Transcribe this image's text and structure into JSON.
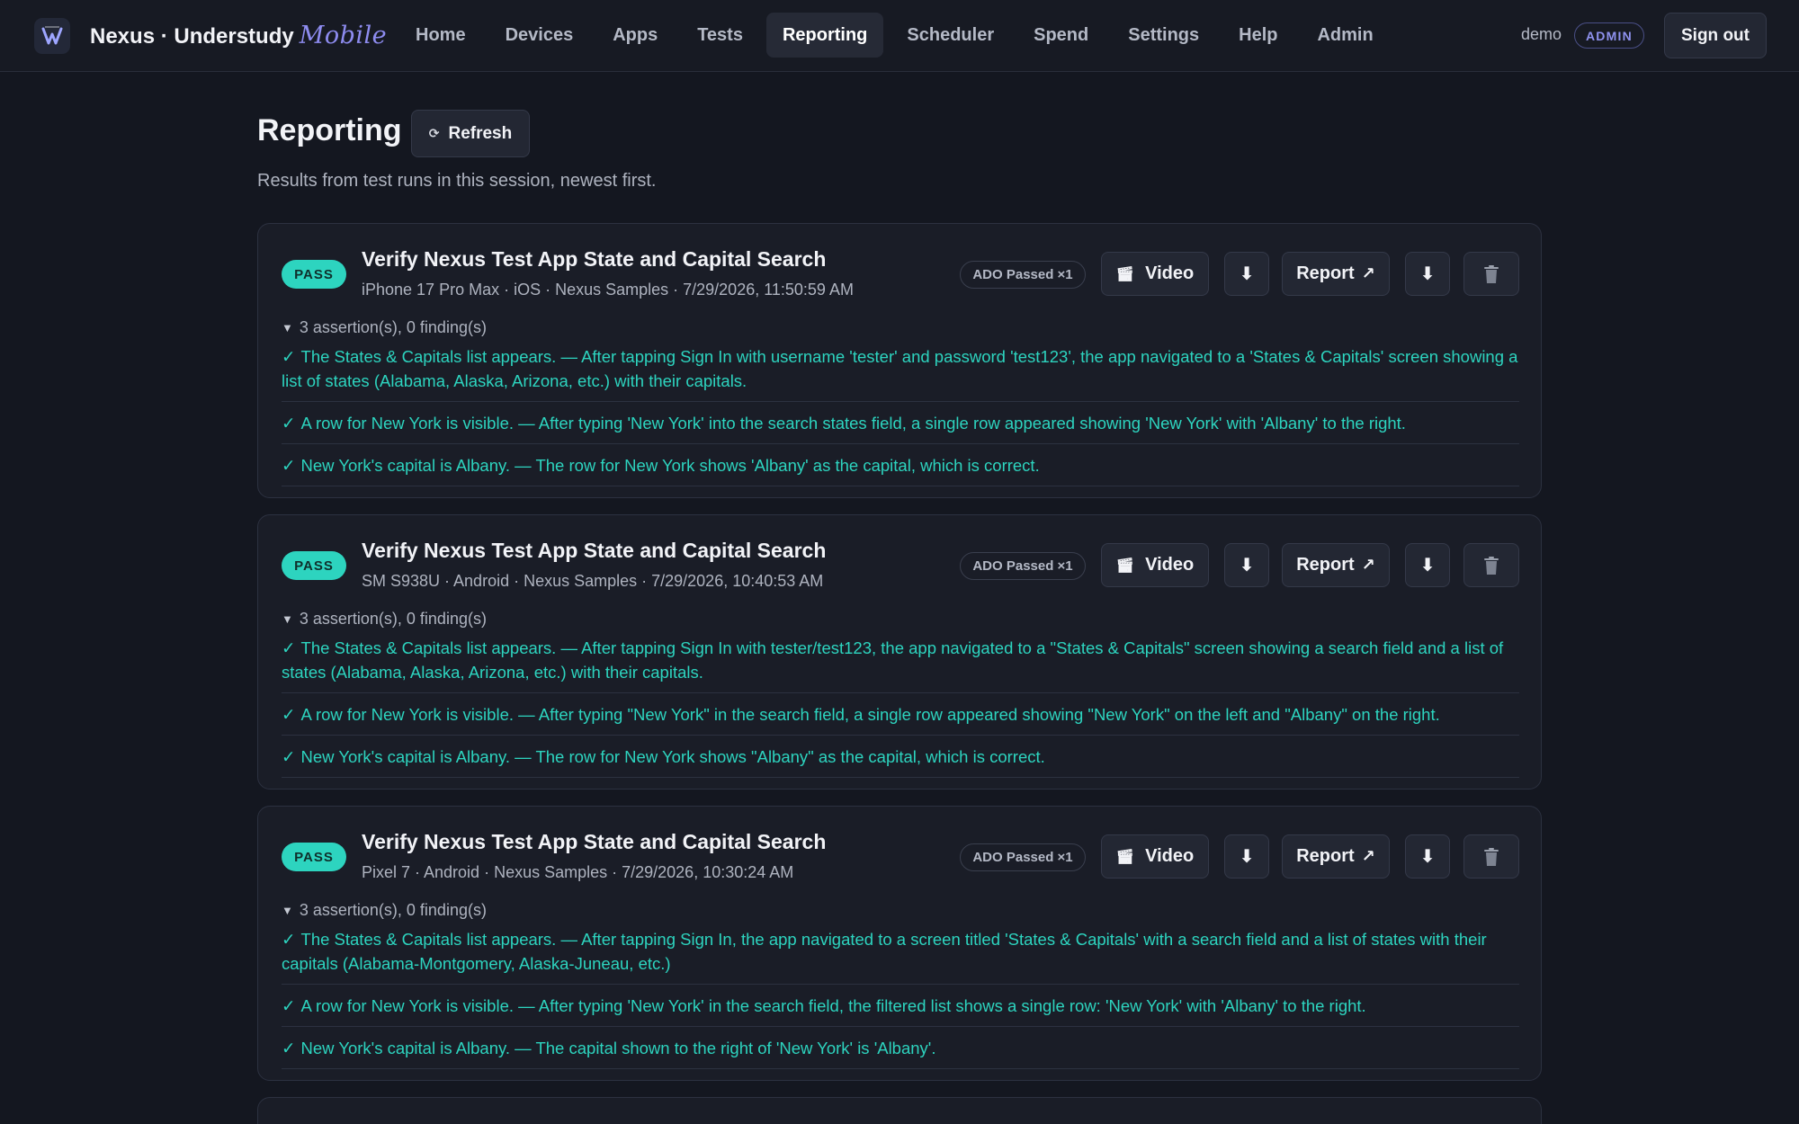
{
  "app": {
    "brand": "Nexus · Understudy",
    "brand_accent": "Mobile",
    "accent_color": "#8e8cf0",
    "pass_color": "#2dd4bf"
  },
  "nav": {
    "items": [
      {
        "label": "Home",
        "active": false
      },
      {
        "label": "Devices",
        "active": false
      },
      {
        "label": "Apps",
        "active": false
      },
      {
        "label": "Tests",
        "active": false
      },
      {
        "label": "Reporting",
        "active": true
      },
      {
        "label": "Scheduler",
        "active": false
      },
      {
        "label": "Spend",
        "active": false
      },
      {
        "label": "Settings",
        "active": false
      },
      {
        "label": "Help",
        "active": false
      },
      {
        "label": "Admin",
        "active": false
      }
    ],
    "user": "demo",
    "role_badge": "ADMIN",
    "signout_label": "Sign out"
  },
  "page": {
    "title": "Reporting",
    "refresh_label": "Refresh",
    "subtitle": "Results from test runs in this session, newest first."
  },
  "results": [
    {
      "status": "PASS",
      "title": "Verify Nexus Test App State and Capital Search",
      "meta": "iPhone 17 Pro Max · iOS · Nexus Samples · 7/29/2026, 11:50:59 AM",
      "ado": "ADO Passed ×1",
      "video_label": "Video",
      "report_label": "Report",
      "summary": "3 assertion(s), 0 finding(s)",
      "assertions": [
        "The States & Capitals list appears. — After tapping Sign In with username 'tester' and password 'test123', the app navigated to a 'States & Capitals' screen showing a list of states (Alabama, Alaska, Arizona, etc.) with their capitals.",
        "A row for New York is visible. — After typing 'New York' into the search states field, a single row appeared showing 'New York' with 'Albany' to the right.",
        "New York's capital is Albany. — The row for New York shows 'Albany' as the capital, which is correct."
      ]
    },
    {
      "status": "PASS",
      "title": "Verify Nexus Test App State and Capital Search",
      "meta": "SM S938U · Android · Nexus Samples · 7/29/2026, 10:40:53 AM",
      "ado": "ADO Passed ×1",
      "video_label": "Video",
      "report_label": "Report",
      "summary": "3 assertion(s), 0 finding(s)",
      "assertions": [
        "The States & Capitals list appears. — After tapping Sign In with tester/test123, the app navigated to a \"States & Capitals\" screen showing a search field and a list of states (Alabama, Alaska, Arizona, etc.) with their capitals.",
        "A row for New York is visible. — After typing \"New York\" in the search field, a single row appeared showing \"New York\" on the left and \"Albany\" on the right.",
        "New York's capital is Albany. — The row for New York shows \"Albany\" as the capital, which is correct."
      ]
    },
    {
      "status": "PASS",
      "title": "Verify Nexus Test App State and Capital Search",
      "meta": "Pixel 7 · Android · Nexus Samples · 7/29/2026, 10:30:24 AM",
      "ado": "ADO Passed ×1",
      "video_label": "Video",
      "report_label": "Report",
      "summary": "3 assertion(s), 0 finding(s)",
      "assertions": [
        "The States & Capitals list appears. — After tapping Sign In, the app navigated to a screen titled 'States & Capitals' with a search field and a list of states with their capitals (Alabama-Montgomery, Alaska-Juneau, etc.)",
        "A row for New York is visible. — After typing 'New York' in the search field, the filtered list shows a single row: 'New York' with 'Albany' to the right.",
        "New York's capital is Albany. — The capital shown to the right of 'New York' is 'Albany'."
      ]
    }
  ]
}
